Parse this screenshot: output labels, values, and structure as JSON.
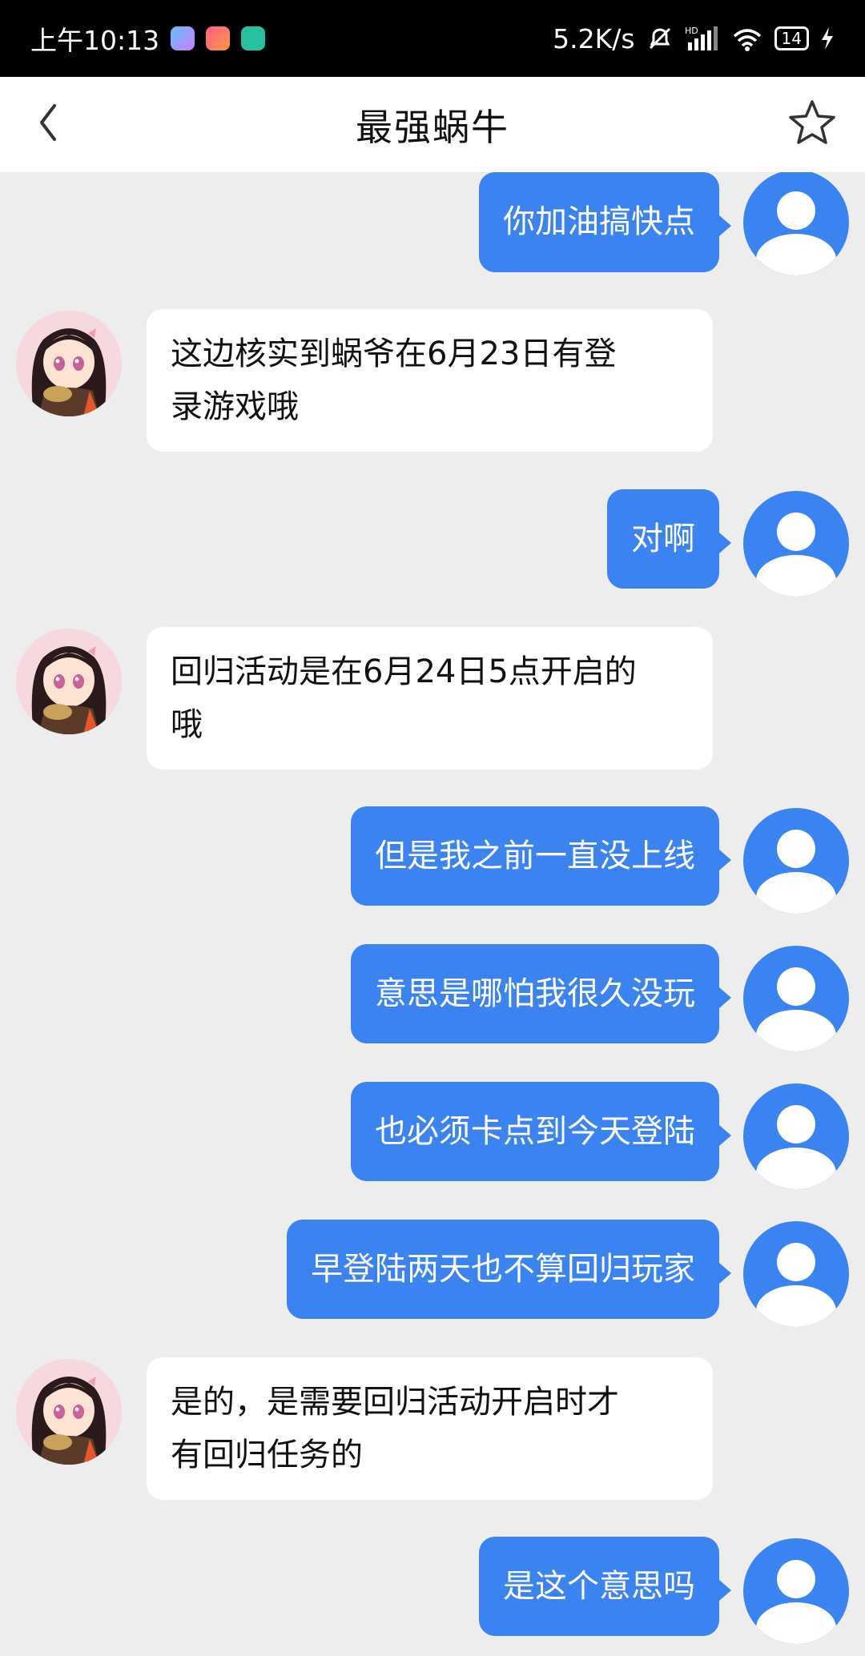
{
  "status_bar": {
    "time": "上午10:13",
    "net_speed": "5.2K/s",
    "battery": "14"
  },
  "header": {
    "title": "最强蜗牛",
    "back_icon": "chevron-left-icon",
    "favorite_icon": "star-outline-icon"
  },
  "colors": {
    "accent": "#3a83f1",
    "background": "#ededed",
    "agent_bubble": "#ffffff"
  },
  "messages": [
    {
      "side": "out",
      "text": "你加油搞快点"
    },
    {
      "side": "in",
      "lines": [
        "这边核实到蜗爷在6月23日有登",
        "录游戏哦"
      ]
    },
    {
      "side": "out",
      "text": "对啊"
    },
    {
      "side": "in",
      "lines": [
        "回归活动是在6月24日5点开启的",
        "哦"
      ]
    },
    {
      "side": "out",
      "text": "但是我之前一直没上线"
    },
    {
      "side": "out",
      "text": "意思是哪怕我很久没玩"
    },
    {
      "side": "out",
      "text": "也必须卡点到今天登陆"
    },
    {
      "side": "out",
      "text": "早登陆两天也不算回归玩家"
    },
    {
      "side": "in",
      "lines": [
        "是的，是需要回归活动开启时才",
        "有回归任务的"
      ]
    },
    {
      "side": "out",
      "text": "是这个意思吗"
    }
  ]
}
